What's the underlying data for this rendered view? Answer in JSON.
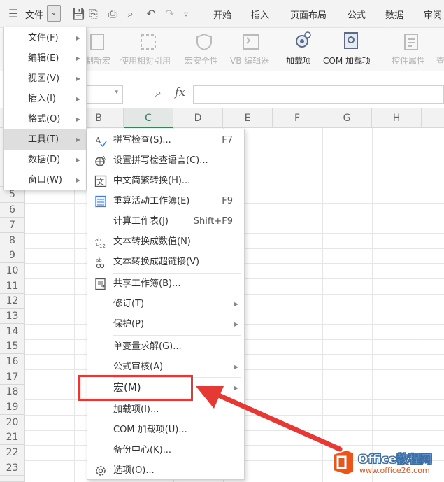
{
  "topbar": {
    "file_label": "文件",
    "tabs": [
      "开始",
      "插入",
      "页面布局",
      "公式",
      "数据",
      "审阅"
    ]
  },
  "ribbon": {
    "items": [
      "制新宏",
      "使用相对引用",
      "宏安全性",
      "VB 编辑器",
      "加载项",
      "COM 加载项",
      "控件属性",
      "查"
    ]
  },
  "formula": {
    "fx": "fx"
  },
  "columns": [
    "B",
    "C",
    "D",
    "E",
    "F",
    "G",
    "H"
  ],
  "rows": [
    "5",
    "6",
    "7",
    "8",
    "9",
    "10",
    "11",
    "12",
    "13",
    "14",
    "15",
    "16",
    "17",
    "18",
    "19",
    "20",
    "21",
    "22",
    "23"
  ],
  "main_menu": [
    {
      "label": "文件(F)"
    },
    {
      "label": "编辑(E)"
    },
    {
      "label": "视图(V)"
    },
    {
      "label": "插入(I)"
    },
    {
      "label": "格式(O)"
    },
    {
      "label": "工具(T)"
    },
    {
      "label": "数据(D)"
    },
    {
      "label": "窗口(W)"
    }
  ],
  "tools_menu": [
    {
      "label": "拼写检查(S)...",
      "shortcut": "F7",
      "icon": "spellcheck-icon"
    },
    {
      "label": "设置拼写检查语言(C)...",
      "shortcut": "",
      "icon": "globe-language-icon"
    },
    {
      "label": "中文简繁转换(H)...",
      "shortcut": "",
      "icon": "chinese-convert-icon"
    },
    {
      "label": "重算活动工作簿(E)",
      "shortcut": "F9",
      "icon": "recalc-icon"
    },
    {
      "label": "计算工作表(J)",
      "shortcut": "Shift+F9",
      "icon": ""
    },
    {
      "label": "文本转换成数值(N)",
      "shortcut": "",
      "icon": "text-to-number-icon"
    },
    {
      "label": "文本转换成超链接(V)",
      "shortcut": "",
      "icon": "text-to-link-icon"
    },
    {
      "label": "共享工作簿(B)...",
      "shortcut": "",
      "icon": "share-workbook-icon"
    },
    {
      "label": "修订(T)",
      "shortcut": "",
      "icon": "",
      "sub": true
    },
    {
      "label": "保护(P)",
      "shortcut": "",
      "icon": "",
      "sub": true
    },
    {
      "label": "单变量求解(G)...",
      "shortcut": "",
      "icon": ""
    },
    {
      "label": "公式审核(A)",
      "shortcut": "",
      "icon": "",
      "sub": true
    },
    {
      "label": "宏(M)",
      "shortcut": "",
      "icon": "",
      "sub": true
    },
    {
      "label": "加载项(I)...",
      "shortcut": "",
      "icon": ""
    },
    {
      "label": "COM 加载项(U)...",
      "shortcut": "",
      "icon": ""
    },
    {
      "label": "备份中心(K)...",
      "shortcut": "",
      "icon": ""
    },
    {
      "label": "选项(O)...",
      "shortcut": "",
      "icon": "gear-icon"
    }
  ],
  "watermark": {
    "brand": "Office教程网",
    "url": "www.office26.com"
  },
  "colors": {
    "highlight": "#e53935",
    "accent": "#e8561c"
  }
}
